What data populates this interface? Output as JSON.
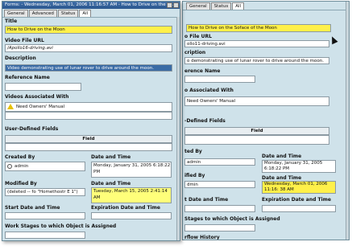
{
  "front": {
    "title": "Forms: - Wednesday, March 01, 2006 11:16:57 AM - How to Drive on the M...",
    "tabs": [
      "General",
      "Advanced",
      "Status",
      "All"
    ],
    "active_tab": "All",
    "fields": {
      "title_label": "Title",
      "title_value": "How to Drive on the Moon",
      "video_url_label": "Video File URL",
      "video_url_value": "/Apollo16-driving.avi",
      "description_label": "Description",
      "description_value": "Video demonstrating use of lunar rover to drive around the moon.",
      "reference_name_label": "Reference Name",
      "videos_assoc_label": "Videos Associated With",
      "videos_assoc_value": "Need Owners' Manual",
      "user_defined_label": "User-Defined Fields",
      "field_header": "Field",
      "created_by_label": "Created By",
      "created_by_value": "admin",
      "created_dt_label": "Date and Time",
      "created_dt_value": "Monday, January 31, 2005 6:18:22 PM",
      "modified_by_label": "Modified By",
      "modified_by_value": "(deleted -- fo \"Homethostr E 1\")",
      "modified_dt_label": "Date and Time",
      "modified_dt_value": "Tuesday, March 15, 2005 2:41:14 AM",
      "start_date_label": "Start Date and Time",
      "expiration_label": "Expiration Date and Time",
      "work_stages_label": "Work Stages to which Object is Assigned"
    }
  },
  "back": {
    "tabs": [
      "General",
      "Advanced",
      "Status",
      "All"
    ],
    "active_tab": "All",
    "fields": {
      "title_value": "How to Drive on the Soface of the Moon",
      "video_url_label": "o File URL",
      "video_url_value": "ollo11-driving.avi",
      "description_label": "cription",
      "description_value": "o demonstrating use of lunar rover to drive around the moon.",
      "reference_label": "erence Name",
      "assoc_label": "o Associated With",
      "assoc_value": "Need Owners' Manual",
      "defined_label": "-Defined Fields",
      "field_header": "Field",
      "created_label": "ted By",
      "created_value": "admin",
      "created_dt_label": "Date and Time",
      "created_dt_value": "Monday, January 31, 2005 6:18:22 PM",
      "modified_label": "ified By",
      "modified_value": "dmin",
      "modified_dt_label": "Date and Time",
      "modified_dt_value": "Wednesday, March 01, 2006 11:16: 38 AM",
      "start_label": "t Date and Time",
      "expiration_label": "Expiration Date and Time",
      "stages_label": "Stages to which Object is Assigned",
      "workflow_label": "rflow History"
    }
  }
}
